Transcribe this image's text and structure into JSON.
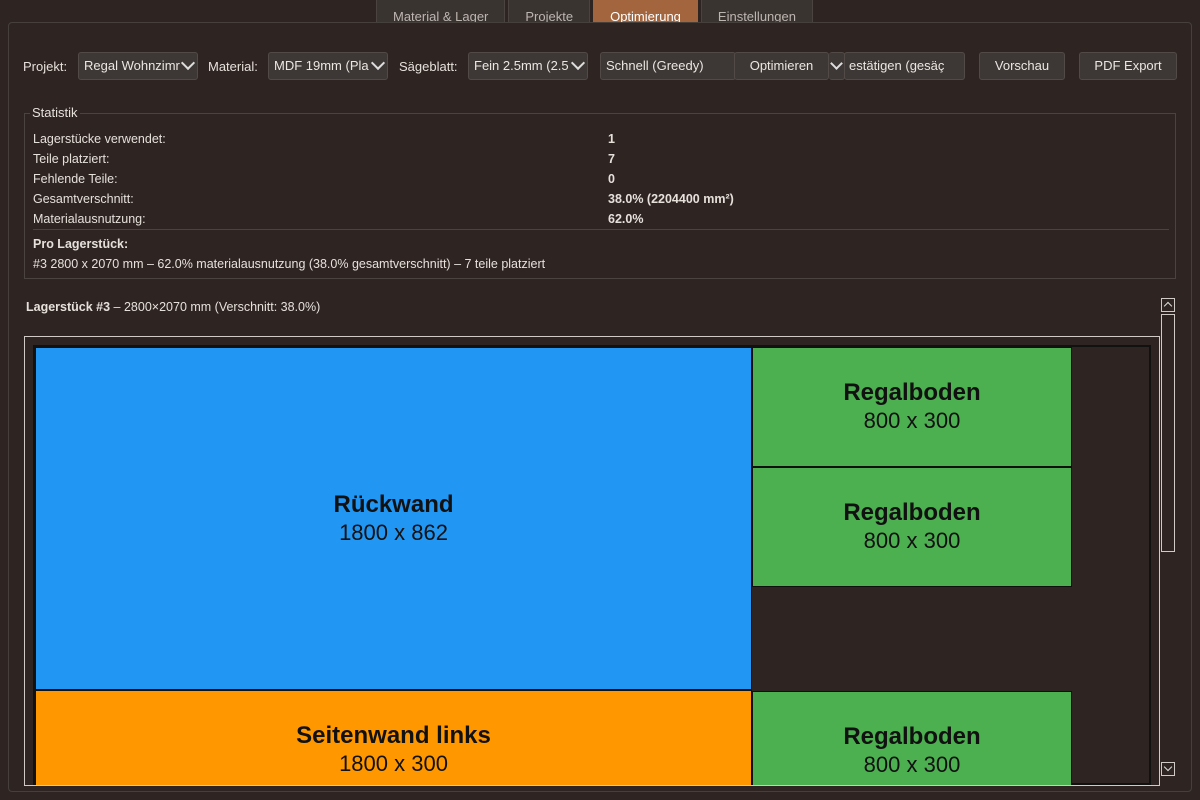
{
  "tabs": [
    "Material & Lager",
    "Projekte",
    "Optimierung",
    "Einstellungen"
  ],
  "active_tab": "Optimierung",
  "toolbar": {
    "projekt_label": "Projekt:",
    "projekt_value": "Regal Wohnzimr",
    "material_label": "Material:",
    "material_value": "MDF 19mm (Pla",
    "saegeblatt_label": "Sägeblatt:",
    "saegeblatt_value": "Fein 2.5mm (2.5",
    "algorithm_value": "Schnell (Greedy)",
    "optimize_label": "Optimieren",
    "confirm_label": "estätigen (gesäç",
    "preview_label": "Vorschau",
    "pdf_label": "PDF Export"
  },
  "stats": {
    "title": "Statistik",
    "rows": [
      {
        "label": "Lagerstücke verwendet:",
        "value": "1"
      },
      {
        "label": "Teile platziert:",
        "value": "7"
      },
      {
        "label": "Fehlende Teile:",
        "value": "0"
      },
      {
        "label": "Gesamtverschnitt:",
        "value": "38.0%  (2204400 mm²)"
      },
      {
        "label": "Materialausnutzung:",
        "value": "62.0%"
      }
    ],
    "per_stock_heading": "Pro Lagerstück:",
    "per_stock_line": "#3  2800 x 2070 mm  –  62.0% materialausnutzung  (38.0% gesamtverschnitt)  –  7 teile platziert"
  },
  "layout": {
    "caption_bold": "Lagerstück #3",
    "caption_rest": " – 2800×2070 mm (Verschnitt: 38.0%)",
    "pieces": [
      {
        "name": "Rückwand",
        "dims": "1800 x 862",
        "color": "#2196f3"
      },
      {
        "name": "Regalboden",
        "dims": "800 x 300",
        "color": "#4caf50"
      },
      {
        "name": "Regalboden",
        "dims": "800 x 300",
        "color": "#4caf50"
      },
      {
        "name": "Seitenwand links",
        "dims": "1800 x 300",
        "color": "#ff9800"
      },
      {
        "name": "Regalboden",
        "dims": "800 x 300",
        "color": "#4caf50"
      }
    ]
  },
  "colors": {
    "accent": "#a3653e",
    "background": "#2e2522"
  }
}
